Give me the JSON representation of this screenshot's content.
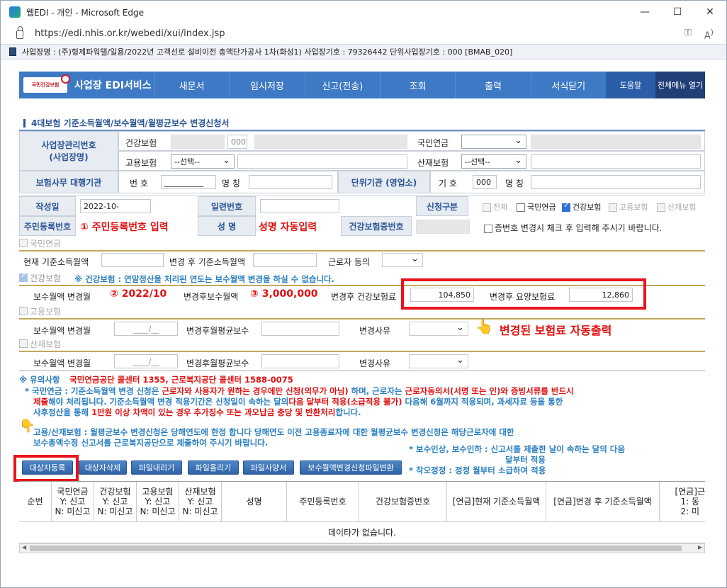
{
  "window": {
    "title": "웹EDI - 개인 - Microsoft Edge",
    "url": "https://edi.nhis.or.kr/webedi/xui/index.jsp"
  },
  "infobar": {
    "text": "사업장명 : (주)형제파워텔/일용/2022년 고객선로 설비이전 총액단가공사 1차(화성1) 사업장기호 : 79326442 단위사업장기호 : 000 [BMAB_020]"
  },
  "nav": {
    "logo_org": "국민건강보험",
    "logo_title": "사업장 EDI서비스",
    "items": [
      "새문서",
      "임시저장",
      "신고(전송)",
      "조회",
      "출력",
      "서식닫기"
    ],
    "help": "도움말",
    "open_menu": "전체메뉴 열기"
  },
  "form": {
    "title": "4대보험 기준소득월액/보수월액/월평균보수 변경신청서",
    "biz_no_label": "사업장관리번호\n(사업장명)",
    "health": "건강보험",
    "health_code": "000",
    "pension": "국민연금",
    "employ": "고용보험",
    "employ_sel": "--선택--",
    "industrial": "산재보험",
    "industrial_sel": "--선택--",
    "agency_label": "보험사무 대행기관",
    "num_label": "번 호",
    "num_value": "__________",
    "name_label": "명 칭",
    "unit_label": "단위기관 (영업소)",
    "sign_label": "기 호",
    "sign_value": "000",
    "unit_name_label": "명 칭",
    "date_label": "작성일",
    "date_value": "2022-10-",
    "serial_label": "일련번호",
    "apply_label": "신청구분",
    "apply_opts": {
      "all": "전체",
      "pension": "국민연금",
      "health": "건강보험",
      "employ": "고용보험",
      "industrial": "산재보험"
    },
    "rrn_label": "주민등록번호",
    "rrn_note": "① 주민등록번호 입력",
    "name2_label": "성 명",
    "name_note": "성명 자동입력",
    "card_label": "건강보험증번호",
    "card_check": "증번호 변경시 체크 후 입력해 주시기 바랍니다."
  },
  "pension": {
    "header": "국민연금",
    "cur_label": "현재 기준소득월액",
    "after_label": "변경 후 기준소득월액",
    "agree_label": "근로자 동의"
  },
  "health": {
    "header": "건강보험",
    "notice": "※ 건강보험 : 연말정산을 처리된 연도는 보수월액 변경을 하실 수 없습니다.",
    "month_label": "보수월액 변경월",
    "month_note": "② 2022/10",
    "pay_label": "변경후보수월액",
    "pay_note": "③ 3,000,000",
    "premium_label": "변경후 건강보험료",
    "premium_value": "104,850",
    "care_label": "변경후 요양보험료",
    "care_value": "12,860"
  },
  "employ": {
    "header": "고용보험",
    "month_label": "보수월액 변경월",
    "month_value": "____/__",
    "avg_label": "변경후월평균보수",
    "reason_label": "변경사유"
  },
  "industrial": {
    "header": "산재보험",
    "month_label": "보수월액 변경월",
    "month_value": "____/__",
    "avg_label": "변경후월평균보수",
    "reason_label": "변경사유"
  },
  "callout": "변경된 보험료 자동출력",
  "notes": {
    "title": "※ 유의사항",
    "contacts": "국민연금공단 콜센터 1355, 근로복지공단 콜센터 1588-0075",
    "p1a": "* 국민연금 : 기준소득월액 변경 신청은 ",
    "p1b": "근로자와 사용자가 원하는 경우에만 신청(의무가 아님)",
    "p1c": " 하며, 근로자는 ",
    "p1d": "근로자동의서(서명 또는 인)와 증빙서류를 반드시",
    "p1e": "제출",
    "p1f": "해야 처리됩니다. 기준소득월액 변경 적용기간은 신청일이 속하는 달의",
    "p1g": "다음 달부터 적용(소급적용 불가)",
    "p1h": " 다음해 6월까지 적용되며, 과세자료 등을 통한",
    "p1i": "사후정산을 통해 ",
    "p1j": "1만원 이상 차액이 있는 경우 추가징수 또는 과오납금 충당 및 반환처리",
    "p1k": "합니다.",
    "p2a": "고용/산재보험 : 월평균보수 변경신청은 당해연도에 한정 합니다 당해연도 이전 고용종료자에 대한 월평균보수 변경신청은 해당근로자에 대한",
    "p2b": "보수총액수정 신고서를 근로복지공단으로 제출하여 주시기 바랍니다.",
    "r1": "* 보수인상, 보수인하 : 신고서를 제출한 날이 속하는 달의 다음",
    "r2": "달부터 적용",
    "r3": "* 착오정정 : 정정 월부터 소급하여 적용"
  },
  "buttons": [
    "대상자등록",
    "대상자삭제",
    "파일내리기",
    "파일올리기",
    "파일사양서",
    "보수월액변경신청파일변환"
  ],
  "table": {
    "headers": [
      "순번",
      "국민연금\nY: 신고\nN: 미신고",
      "건강보험\nY: 신고\nN: 미신고",
      "고용보험\nY: 신고\nN: 미신고",
      "산재보험\nY: 신고\nN: 미신고",
      "성명",
      "주민등록번호",
      "건강보험증번호",
      "[연금]현재 기준소득월액",
      "[연금]변경 후 기준소득월액",
      "[연금]근\n1: 동\n2: 미"
    ],
    "empty": "데이타가 없습니다."
  }
}
